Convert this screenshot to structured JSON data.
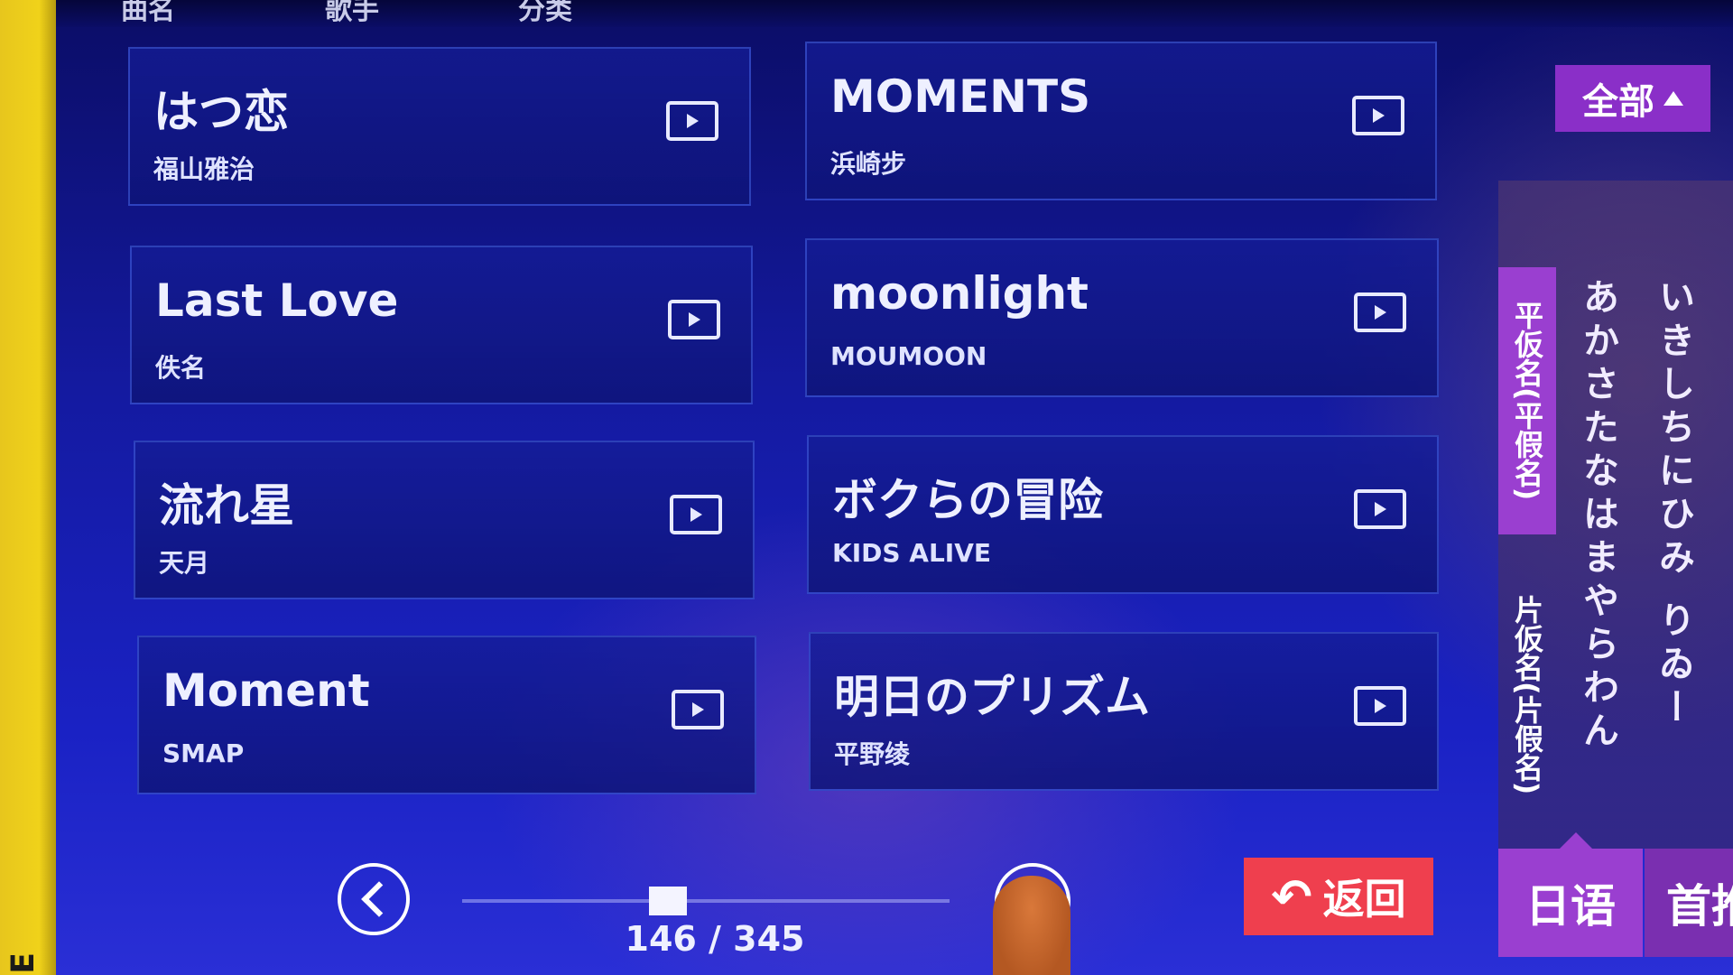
{
  "side_text": "ᴇ",
  "top_cut": [
    "曲名",
    "歌手",
    "分类"
  ],
  "songs": [
    {
      "title": "はつ恋",
      "artist": "福山雅治"
    },
    {
      "title": "MOMENTS",
      "artist": "浜崎步"
    },
    {
      "title": "Last Love",
      "artist": "佚名"
    },
    {
      "title": "moonlight",
      "artist": "MOUMOON"
    },
    {
      "title": "流れ星",
      "artist": "天月"
    },
    {
      "title": "ボクらの冒险",
      "artist": "KIDS ALIVE"
    },
    {
      "title": "Moment",
      "artist": "SMAP"
    },
    {
      "title": "明日のプリズム",
      "artist": "平野绫"
    }
  ],
  "filter": {
    "label": "全部"
  },
  "kana_tabs": {
    "hiragana": "平仮名(平假名)",
    "katakana": "片仮名(片假名)"
  },
  "kana_columns": [
    "あかさたなはまやらわん",
    "いきしちにひみ りゐー"
  ],
  "pagination": {
    "current": 146,
    "total": 345,
    "display": "146 / 345",
    "progress": 0.423
  },
  "buttons": {
    "return": "返回",
    "language": "日语",
    "home": "首推"
  },
  "colors": {
    "accent": "#9a3fd0",
    "return": "#ef3f4e",
    "bg": "#141aa0"
  }
}
